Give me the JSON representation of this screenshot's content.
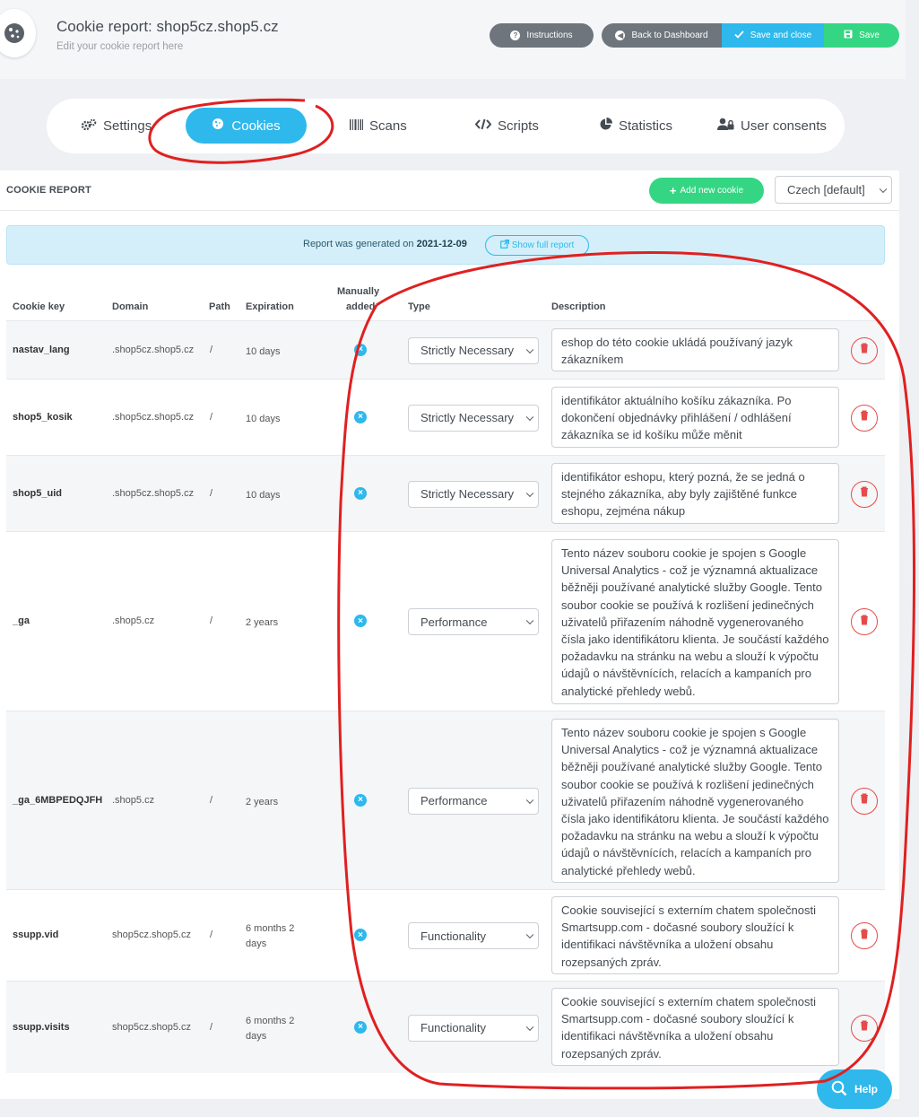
{
  "header": {
    "title": "Cookie report: shop5cz.shop5.cz",
    "subtitle": "Edit your cookie report here",
    "instructions_label": "Instructions",
    "back_label": "Back to Dashboard",
    "save_close_label": "Save and close",
    "save_label": "Save"
  },
  "tabs": [
    {
      "label": "Settings",
      "icon": "gears-icon"
    },
    {
      "label": "Cookies",
      "icon": "cookie-icon",
      "active": true
    },
    {
      "label": "Scans",
      "icon": "barcode-icon"
    },
    {
      "label": "Scripts",
      "icon": "code-icon"
    },
    {
      "label": "Statistics",
      "icon": "pie-chart-icon"
    },
    {
      "label": "User consents",
      "icon": "users-icon"
    }
  ],
  "report": {
    "title": "COOKIE REPORT",
    "add_label": "Add new cookie",
    "language": "Czech [default]",
    "info_prefix": "Report was generated on",
    "info_date": "2021-12-09",
    "show_full_label": "Show full report"
  },
  "table": {
    "headers": {
      "key": "Cookie key",
      "domain": "Domain",
      "path": "Path",
      "expiration": "Expiration",
      "manual_1": "Manually",
      "manual_2": "added",
      "type": "Type",
      "description": "Description"
    },
    "rows": [
      {
        "key": "nastav_lang",
        "domain": ".shop5cz.shop5.cz",
        "path": "/",
        "expiration": "10 days",
        "type": "Strictly Necessary",
        "description": " eshop do této cookie ukládá používaný jazyk zákazníkem"
      },
      {
        "key": "shop5_kosik",
        "domain": ".shop5cz.shop5.cz",
        "path": "/",
        "expiration": "10 days",
        "type": "Strictly Necessary",
        "description": "identifikátor aktuálního košíku zákazníka. Po dokončení objednávky přihlášení / odhlášení zákazníka se id košíku může měnit"
      },
      {
        "key": "shop5_uid",
        "domain": ".shop5cz.shop5.cz",
        "path": "/",
        "expiration": "10 days",
        "type": "Strictly Necessary",
        "description": "identifikátor eshopu, který pozná, že se jedná o stejného zákazníka, aby byly zajištěné funkce eshopu, zejména nákup"
      },
      {
        "key": "_ga",
        "domain": ".shop5.cz",
        "path": "/",
        "expiration": "2 years",
        "type": "Performance",
        "description": "Tento název souboru cookie je spojen s Google Universal Analytics - což je významná aktualizace běžněji používané analytické služby Google. Tento soubor cookie se používá k rozlišení jedinečných uživatelů přiřazením náhodně vygenerovaného čísla jako identifikátoru klienta. Je součástí každého požadavku na stránku na webu a slouží k výpočtu údajů o návštěvnících, relacích a kampaních pro analytické přehledy webů."
      },
      {
        "key": "_ga_6MBPEDQJFH",
        "domain": ".shop5.cz",
        "path": "/",
        "expiration": "2 years",
        "type": "Performance",
        "description": "Tento název souboru cookie je spojen s Google Universal Analytics - což je významná aktualizace běžněji používané analytické služby Google. Tento soubor cookie se používá k rozlišení jedinečných uživatelů přiřazením náhodně vygenerovaného čísla jako identifikátoru klienta. Je součástí každého požadavku na stránku na webu a slouží k výpočtu údajů o návštěvnících, relacích a kampaních pro analytické přehledy webů."
      },
      {
        "key": "ssupp.vid",
        "domain": "shop5cz.shop5.cz",
        "path": "/",
        "expiration": "6 months 2 days",
        "type": "Functionality",
        "description": "Cookie související s externím chatem společnosti Smartsupp.com - dočasné soubory sloužící k identifikaci návštěvníka a uložení obsahu rozepsaných zpráv."
      },
      {
        "key": "ssupp.visits",
        "domain": "shop5cz.shop5.cz",
        "path": "/",
        "expiration": "6 months 2 days",
        "type": "Functionality",
        "description": "Cookie související s externím chatem společnosti Smartsupp.com - dočasné soubory sloužící k identifikaci návštěvníka a uložení obsahu rozepsaných zpráv."
      }
    ]
  },
  "help_label": "Help",
  "colors": {
    "accent": "#2fb8ec",
    "success": "#34d683",
    "neutral_button": "#6e757c",
    "danger": "#e64b4b",
    "annotation": "#e02020"
  }
}
